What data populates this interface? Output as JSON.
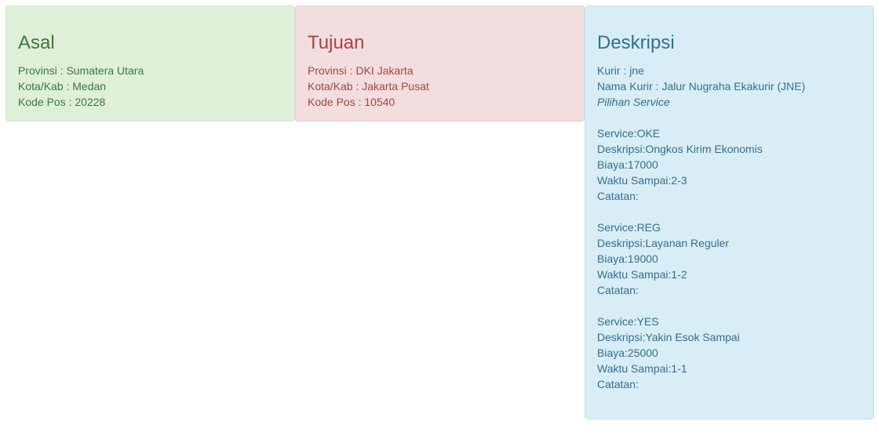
{
  "asal": {
    "title": "Asal",
    "provinsi": "Provinsi : Sumatera Utara",
    "kota": "Kota/Kab : Medan",
    "kodepos": "Kode Pos : 20228"
  },
  "tujuan": {
    "title": "Tujuan",
    "provinsi": "Provinsi : DKI Jakarta",
    "kota": "Kota/Kab : Jakarta Pusat",
    "kodepos": "Kode Pos : 10540"
  },
  "deskripsi": {
    "title": "Deskripsi",
    "kurir": "Kurir : jne",
    "nama_kurir": "Nama Kurir : Jalur Nugraha Ekakurir (JNE)",
    "pilihan_label": "Pilihan Service",
    "services": [
      {
        "service": "Service:OKE",
        "deskripsi": "Deskripsi:Ongkos Kirim Ekonomis",
        "biaya": "Biaya:17000",
        "waktu": "Waktu Sampai:2-3",
        "catatan": "Catatan:"
      },
      {
        "service": "Service:REG",
        "deskripsi": "Deskripsi:Layanan Reguler",
        "biaya": "Biaya:19000",
        "waktu": "Waktu Sampai:1-2",
        "catatan": "Catatan:"
      },
      {
        "service": "Service:YES",
        "deskripsi": "Deskripsi:Yakin Esok Sampai",
        "biaya": "Biaya:25000",
        "waktu": "Waktu Sampai:1-1",
        "catatan": "Catatan:"
      }
    ]
  },
  "colors": {
    "success_bg": "#dff0d8",
    "success_text": "#3c763d",
    "danger_bg": "#f2dede",
    "danger_text": "#a94442",
    "info_bg": "#d9edf7",
    "info_text": "#31708f"
  }
}
